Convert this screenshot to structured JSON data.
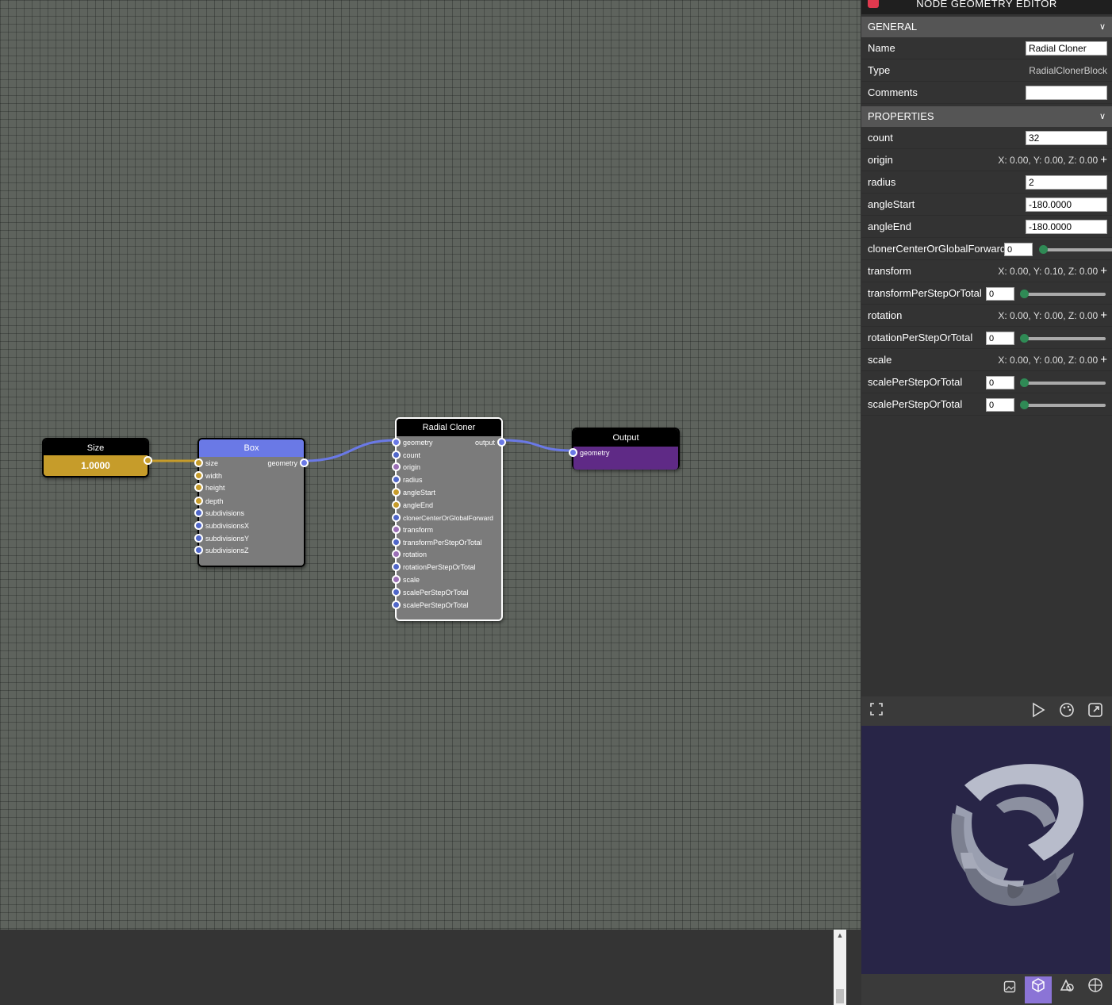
{
  "graph": {
    "size_node": {
      "title": "Size",
      "value": "1.0000"
    },
    "box_node": {
      "title": "Box",
      "inputs": [
        "size",
        "width",
        "height",
        "depth",
        "subdivisions",
        "subdivisionsX",
        "subdivisionsY",
        "subdivisionsZ"
      ],
      "output": "geometry"
    },
    "cloner_node": {
      "title": "Radial Cloner",
      "inputs": [
        "geometry",
        "count",
        "origin",
        "radius",
        "angleStart",
        "angleEnd",
        "clonerCenterOrGlobalForward",
        "transform",
        "transformPerStepOrTotal",
        "rotation",
        "rotationPerStepOrTotal",
        "scale",
        "scalePerStepOrTotal",
        "scalePerStepOrTotal"
      ],
      "output": "output"
    },
    "output_node": {
      "title": "Output",
      "input": "geometry"
    }
  },
  "panel": {
    "title": "NODE GEOMETRY EDITOR",
    "general": {
      "header": "GENERAL",
      "name_label": "Name",
      "name_value": "Radial Cloner",
      "type_label": "Type",
      "type_value": "RadialClonerBlock",
      "comments_label": "Comments",
      "comments_value": ""
    },
    "properties": {
      "header": "PROPERTIES",
      "count_label": "count",
      "count_value": "32",
      "origin_label": "origin",
      "origin_value": "X: 0.00, Y: 0.00, Z: 0.00",
      "radius_label": "radius",
      "radius_value": "2",
      "angleStart_label": "angleStart",
      "angleStart_value": "-180.0000",
      "angleEnd_label": "angleEnd",
      "angleEnd_value": "-180.0000",
      "ccogf_label": "clonerCenterOrGlobalForward",
      "ccogf_value": "0",
      "transform_label": "transform",
      "transform_value": "X: 0.00, Y: 0.10, Z: 0.00",
      "tpsot_label": "transformPerStepOrTotal",
      "tpsot_value": "0",
      "rotation_label": "rotation",
      "rotation_value": "X: 0.00, Y: 0.00, Z: 0.00",
      "rpsot_label": "rotationPerStepOrTotal",
      "rpsot_value": "0",
      "scale_label": "scale",
      "scale_value": "X: 0.00, Y: 0.00, Z: 0.00",
      "spsot1_label": "scalePerStepOrTotal",
      "spsot1_value": "0",
      "spsot2_label": "scalePerStepOrTotal",
      "spsot2_value": "0"
    }
  },
  "icons": {
    "fullscreen": "fullscreen-icon",
    "play": "play-icon",
    "palette": "palette-icon",
    "popout": "popout-icon",
    "image": "image-icon",
    "cube": "cube-icon",
    "shapes": "shapes-icon",
    "globe": "globe-icon"
  },
  "colors": {
    "accent": "#8b74d6",
    "size_node": "#c69c2a",
    "box_header": "#6a79e6",
    "output_body": "#5f2a86",
    "link_geo": "#6a79e6",
    "link_float": "#c69c2a",
    "preview_bg": "#282547"
  }
}
